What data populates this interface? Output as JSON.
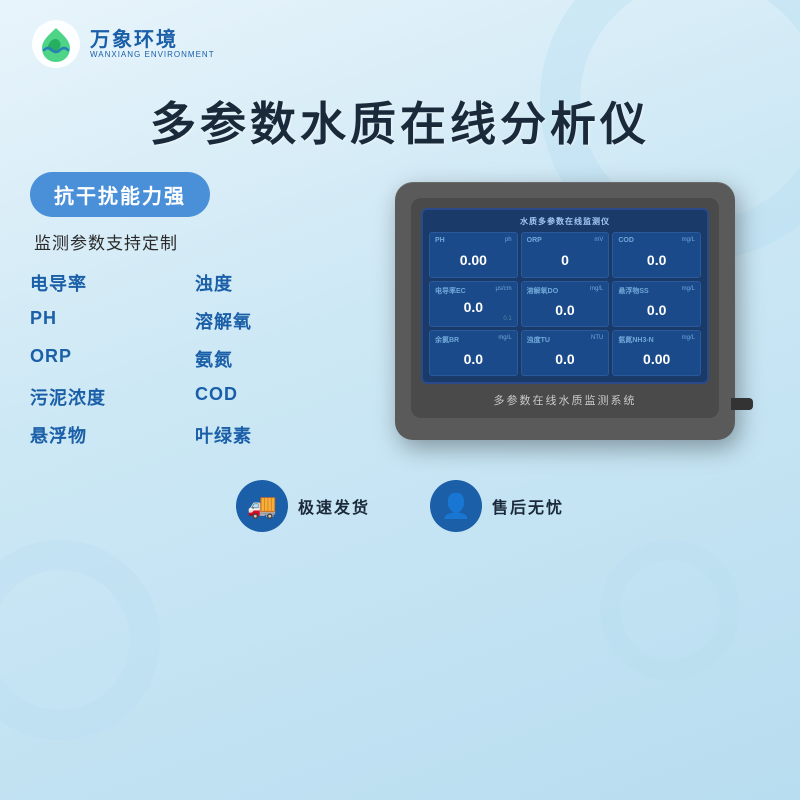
{
  "brand": {
    "logo_cn": "万象环境",
    "logo_en": "WANXIANG ENVIRONMENT"
  },
  "main_title": "多参数水质在线分析仪",
  "left_panel": {
    "badge": "抗干扰能力强",
    "support_text": "监测参数支持定制",
    "params": [
      {
        "label": "电导率"
      },
      {
        "label": "浊度"
      },
      {
        "label": "PH"
      },
      {
        "label": "溶解氧"
      },
      {
        "label": "ORP"
      },
      {
        "label": "氨氮"
      },
      {
        "label": "污泥浓度"
      },
      {
        "label": "COD"
      },
      {
        "label": "悬浮物"
      },
      {
        "label": "叶绿素"
      }
    ]
  },
  "device": {
    "screen_title": "水质多参数在线监测仪",
    "bottom_label": "多参数在线水质监测系统",
    "cells": [
      {
        "name": "PH",
        "subname": "ph",
        "unit": "",
        "value": "0.00",
        "sublabel": ""
      },
      {
        "name": "ORP",
        "subname": "",
        "unit": "mV",
        "value": "0",
        "sublabel": ""
      },
      {
        "name": "COD",
        "subname": "",
        "unit": "mg/L",
        "value": "0.0",
        "sublabel": ""
      },
      {
        "name": "电导率EC",
        "subname": "",
        "unit": "μs/cm",
        "value": "0.0",
        "sublabel": "0.1"
      },
      {
        "name": "溶解氧DO",
        "subname": "",
        "unit": "mg/L",
        "value": "0.0",
        "sublabel": ""
      },
      {
        "name": "悬浮物SS",
        "subname": "",
        "unit": "mg/L",
        "value": "0.0",
        "sublabel": ""
      },
      {
        "name": "余氯BR",
        "subname": "",
        "unit": "mg/L",
        "value": "0.0",
        "sublabel": ""
      },
      {
        "name": "浊度TU",
        "subname": "",
        "unit": "NTU",
        "value": "0.0",
        "sublabel": ""
      },
      {
        "name": "氨氮NH3-N",
        "subname": "",
        "unit": "mg/L",
        "value": "0.00",
        "sublabel": ""
      }
    ]
  },
  "bottom_features": [
    {
      "icon": "🚚",
      "text": "极速发货"
    },
    {
      "icon": "👤",
      "text": "售后无忧"
    }
  ]
}
